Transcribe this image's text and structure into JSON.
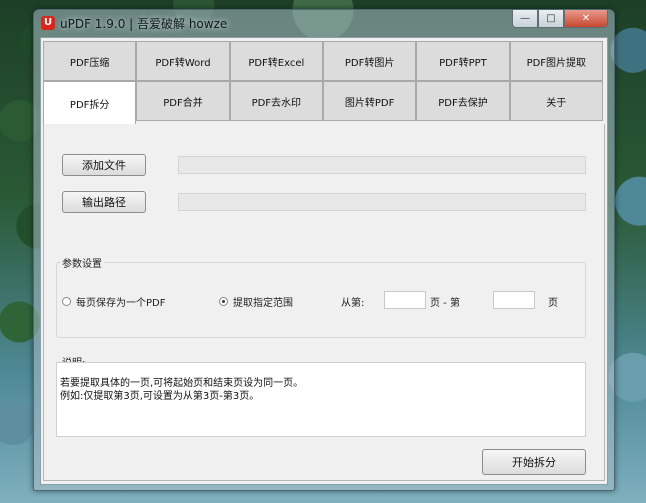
{
  "window": {
    "title": "uPDF 1.9.0 |  吾爱破解 howze",
    "icon_letter": "U",
    "controls": {
      "minimize": "—",
      "maximize": "□",
      "close": "✕"
    }
  },
  "tabs_row1": [
    "PDF压缩",
    "PDF转Word",
    "PDF转Excel",
    "PDF转图片",
    "PDF转PPT",
    "PDF图片提取"
  ],
  "tabs_row2": [
    "PDF拆分",
    "PDF合并",
    "PDF去水印",
    "图片转PDF",
    "PDF去保护",
    "关于"
  ],
  "active_tab": "PDF拆分",
  "file_section": {
    "add_file_label": "添加文件",
    "output_path_label": "输出路径",
    "file_path_value": "",
    "output_path_value": ""
  },
  "params": {
    "group_title": "参数设置",
    "radio_each_page": "每页保存为一个PDF",
    "radio_range": "提取指定范围",
    "selected": "range",
    "from_label": "从第:",
    "page_dash": "页 - 第",
    "page_suffix": "页",
    "from_value": "",
    "to_value": ""
  },
  "notes": {
    "group_title": "说明:",
    "line1": "若要提取具体的一页,可将起始页和结束页设为同一页。",
    "line2": "例如:仅提取第3页,可设置为从第3页-第3页。"
  },
  "start_button_label": "开始拆分"
}
